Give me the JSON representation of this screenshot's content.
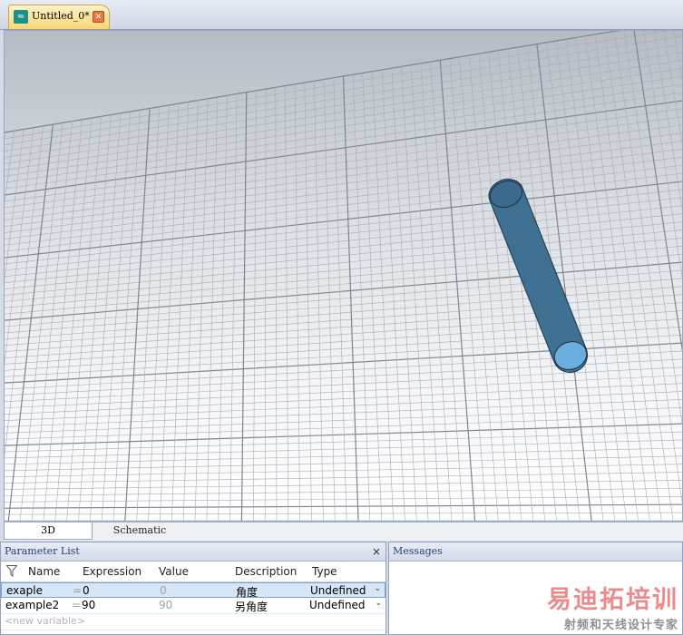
{
  "document_tab": {
    "title": "Untitled_0*",
    "icon": "app-waves-icon",
    "close_icon": "close-icon",
    "accent": "#f6d677"
  },
  "viewport": {
    "background_top": "#b6bbc4",
    "background_bottom": "#ffffff",
    "object": "cylinder",
    "object_color": "#3f6f91"
  },
  "view_tabs": [
    "3D",
    "Schematic"
  ],
  "parameter_list": {
    "title": "Parameter List",
    "columns": [
      "Name",
      "Expression",
      "Value",
      "Description",
      "Type"
    ],
    "rows": [
      {
        "name": "exaple",
        "eq": "=",
        "expression": "0",
        "value": "0",
        "description": "角度",
        "type": "Undefined"
      },
      {
        "name": "example2",
        "eq": "=",
        "expression": "90",
        "value": "90",
        "description": "另角度",
        "type": "Undefined"
      }
    ],
    "new_variable_placeholder": "<new variable>",
    "close_label": "×"
  },
  "messages": {
    "title": "Messages"
  },
  "watermark": {
    "line1": "易迪拓培训",
    "line2": "射频和天线设计专家"
  }
}
